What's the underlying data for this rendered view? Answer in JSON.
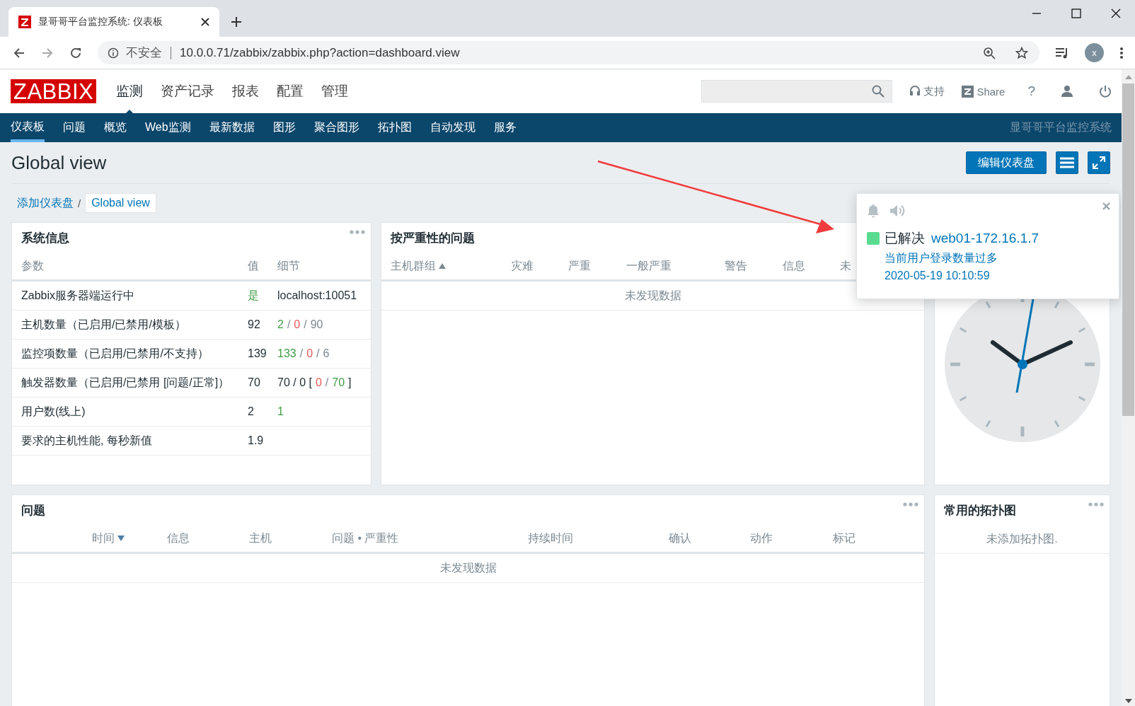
{
  "browser": {
    "tab_title": "显哥哥平台监控系统: 仪表板",
    "security_label": "不安全",
    "url": "10.0.0.71/zabbix/zabbix.php?action=dashboard.view",
    "avatar_letter": "x"
  },
  "header": {
    "logo": "ZABBIX",
    "menu": [
      {
        "label": "监测",
        "selected": true
      },
      {
        "label": "资产记录",
        "selected": false
      },
      {
        "label": "报表",
        "selected": false
      },
      {
        "label": "配置",
        "selected": false
      },
      {
        "label": "管理",
        "selected": false
      }
    ],
    "support": "支持",
    "share": "Share",
    "help": "?"
  },
  "nav": {
    "items": [
      {
        "label": "仪表板",
        "selected": true
      },
      {
        "label": "问题",
        "selected": false
      },
      {
        "label": "概览",
        "selected": false
      },
      {
        "label": "Web监测",
        "selected": false
      },
      {
        "label": "最新数据",
        "selected": false
      },
      {
        "label": "图形",
        "selected": false
      },
      {
        "label": "聚合图形",
        "selected": false
      },
      {
        "label": "拓扑图",
        "selected": false
      },
      {
        "label": "自动发现",
        "selected": false
      },
      {
        "label": "服务",
        "selected": false
      }
    ],
    "brand": "显哥哥平台监控系统"
  },
  "page": {
    "title": "Global view",
    "edit_button": "编辑仪表盘",
    "breadcrumb_separator": "/",
    "breadcrumb": [
      {
        "label": "添加仪表盘",
        "selected": false
      },
      {
        "label": "Global view",
        "selected": true
      }
    ]
  },
  "system_info": {
    "title": "系统信息",
    "columns": [
      "参数",
      "值",
      "细节"
    ],
    "rows": [
      {
        "parameter": "Zabbix服务器端运行中",
        "value": "是",
        "kind": "ok",
        "details": [
          {
            "text": "localhost:10051",
            "kind": "plain"
          }
        ]
      },
      {
        "parameter": "主机数量（已启用/已禁用/模板）",
        "value": "92",
        "kind": "plain",
        "details": [
          {
            "text": "2",
            "kind": "ok"
          },
          {
            "text": "/",
            "kind": "muted"
          },
          {
            "text": "0",
            "kind": "problem"
          },
          {
            "text": "/",
            "kind": "muted"
          },
          {
            "text": "90",
            "kind": "muted"
          }
        ]
      },
      {
        "parameter": "监控项数量（已启用/已禁用/不支持）",
        "value": "139",
        "kind": "plain",
        "details": [
          {
            "text": "133",
            "kind": "ok"
          },
          {
            "text": "/",
            "kind": "muted"
          },
          {
            "text": "0",
            "kind": "problem"
          },
          {
            "text": "/",
            "kind": "muted"
          },
          {
            "text": "6",
            "kind": "muted"
          }
        ]
      },
      {
        "parameter": "触发器数量（已启用/已禁用 [问题/正常]）",
        "value": "70",
        "kind": "plain",
        "details": [
          {
            "text": "70 / 0 [",
            "kind": "plain"
          },
          {
            "text": "0",
            "kind": "problem"
          },
          {
            "text": "/",
            "kind": "muted"
          },
          {
            "text": "70",
            "kind": "ok"
          },
          {
            "text": "]",
            "kind": "plain"
          }
        ]
      },
      {
        "parameter": "用户数(线上)",
        "value": "2",
        "kind": "plain",
        "details": [
          {
            "text": "1",
            "kind": "ok"
          }
        ]
      },
      {
        "parameter": "要求的主机性能, 每秒新值",
        "value": "1.9",
        "kind": "plain",
        "details": []
      }
    ]
  },
  "severity": {
    "title": "按严重性的问题",
    "columns": [
      {
        "label": "主机群组",
        "kind": "ascending"
      },
      {
        "label": "灾难",
        "kind": "plain"
      },
      {
        "label": "严重",
        "kind": "plain"
      },
      {
        "label": "一般严重",
        "kind": "plain"
      },
      {
        "label": "警告",
        "kind": "plain"
      },
      {
        "label": "信息",
        "kind": "plain"
      },
      {
        "label": "未",
        "kind": "plain"
      }
    ],
    "empty": "未发现数据"
  },
  "problems": {
    "title": "问题",
    "columns": [
      {
        "label": "时间",
        "kind": "descending"
      },
      {
        "label": "信息",
        "kind": "plain"
      },
      {
        "label": "主机",
        "kind": "plain"
      },
      {
        "label": "问题 • 严重性",
        "kind": "plain"
      },
      {
        "label": "持续时间",
        "kind": "plain"
      },
      {
        "label": "确认",
        "kind": "plain"
      },
      {
        "label": "动作",
        "kind": "plain"
      },
      {
        "label": "标记",
        "kind": "plain"
      }
    ],
    "empty": "未发现数据"
  },
  "maps": {
    "title": "常用的拓扑图",
    "empty": "未添加拓扑图."
  },
  "notification": {
    "status": "已解决",
    "color": "#59db8f",
    "host": "web01-172.16.1.7",
    "problem": "当前用户登录数量过多",
    "time": "2020-05-19 10:10:59"
  }
}
